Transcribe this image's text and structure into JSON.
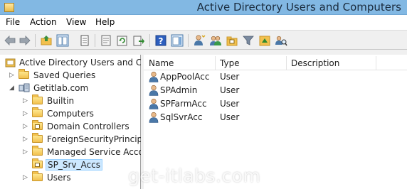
{
  "window": {
    "title": "Active Directory Users and Computers",
    "app_icon": "ad-console-icon"
  },
  "menu": {
    "items": [
      {
        "label": "File"
      },
      {
        "label": "Action"
      },
      {
        "label": "View"
      },
      {
        "label": "Help"
      }
    ]
  },
  "toolbar": {
    "buttons": [
      "back-arrow-icon",
      "forward-arrow-icon",
      "up-folder-icon",
      "show-console-tree-icon",
      "delete-icon",
      "properties-icon",
      "refresh-icon",
      "export-list-icon",
      "help-icon",
      "show-action-pane-icon",
      "new-user-icon",
      "new-group-icon",
      "new-ou-icon",
      "filter-icon",
      "add-to-group-icon",
      "find-icon"
    ]
  },
  "tree": {
    "root": {
      "label": "Active Directory Users and Com"
    },
    "items": [
      {
        "label": "Saved Queries",
        "expander": "▷",
        "type": "folder"
      },
      {
        "label": "Getitlab.com",
        "expander": "◢",
        "type": "domain"
      },
      {
        "label": "Builtin",
        "expander": "▷",
        "type": "folder"
      },
      {
        "label": "Computers",
        "expander": "▷",
        "type": "folder"
      },
      {
        "label": "Domain Controllers",
        "expander": "▷",
        "type": "ou"
      },
      {
        "label": "ForeignSecurityPrincipals",
        "expander": "▷",
        "type": "folder"
      },
      {
        "label": "Managed Service Accour",
        "expander": "▷",
        "type": "folder"
      },
      {
        "label": "SP_Srv_Accs",
        "expander": "",
        "type": "ou",
        "selected": true
      },
      {
        "label": "Users",
        "expander": "▷",
        "type": "folder"
      }
    ]
  },
  "list": {
    "columns": {
      "name": "Name",
      "type": "Type",
      "description": "Description"
    },
    "rows": [
      {
        "name": "AppPoolAcc",
        "type": "User"
      },
      {
        "name": "SPAdmin",
        "type": "User"
      },
      {
        "name": "SPFarmAcc",
        "type": "User"
      },
      {
        "name": "SqlSvrAcc",
        "type": "User"
      }
    ]
  },
  "watermark": "get-itlabs.com"
}
